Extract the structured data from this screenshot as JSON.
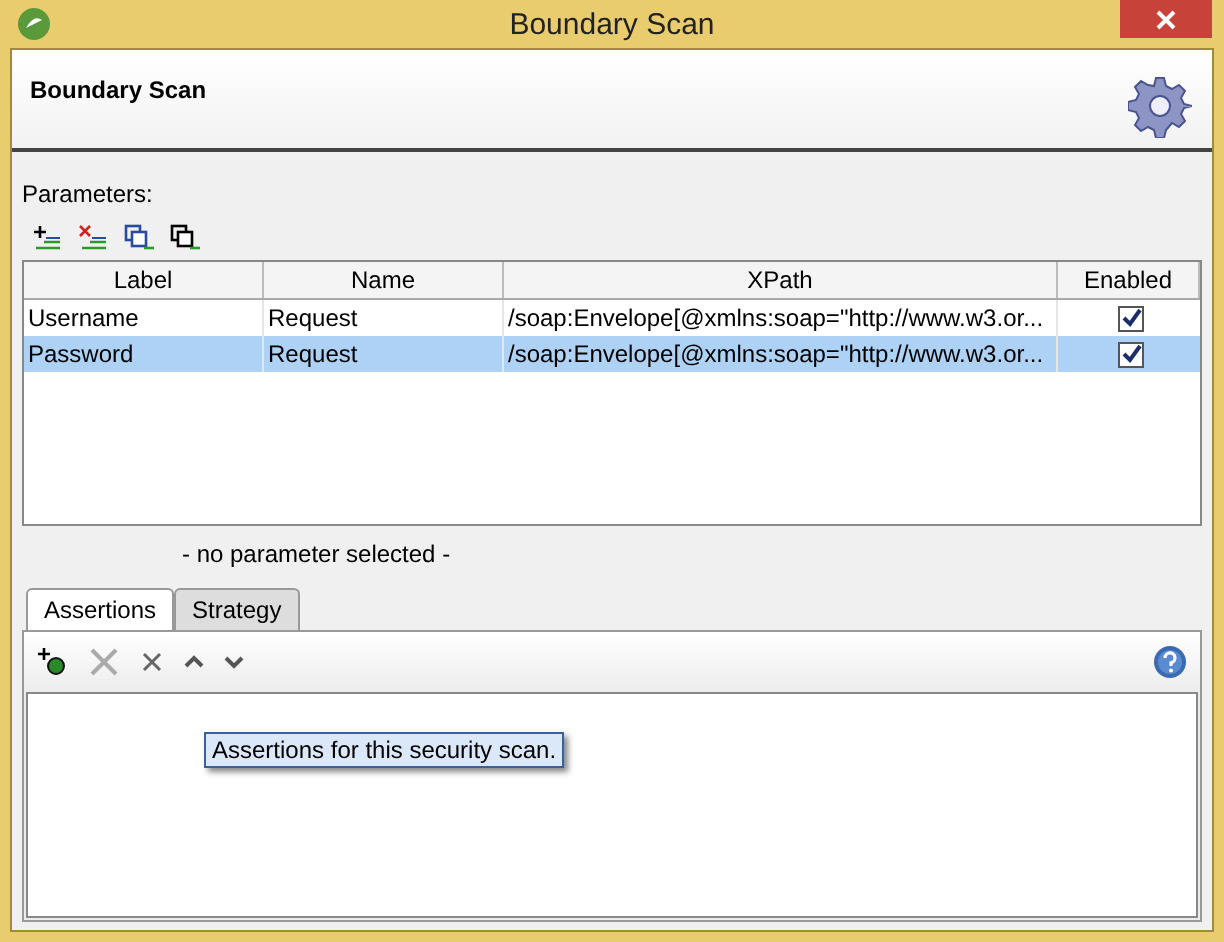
{
  "window": {
    "title": "Boundary Scan"
  },
  "header": {
    "title": "Boundary Scan"
  },
  "parameters": {
    "label": "Parameters:",
    "table": {
      "columns": [
        "Label",
        "Name",
        "XPath",
        "Enabled"
      ],
      "rows": [
        {
          "label": "Username",
          "name": "Request",
          "xpath": "/soap:Envelope[@xmlns:soap=\"http://www.w3.or...",
          "enabled": true,
          "selected": false
        },
        {
          "label": "Password",
          "name": "Request",
          "xpath": "/soap:Envelope[@xmlns:soap=\"http://www.w3.or...",
          "enabled": true,
          "selected": true
        }
      ]
    },
    "status": "- no parameter selected -"
  },
  "tabs": [
    {
      "label": "Assertions",
      "selected": true
    },
    {
      "label": "Strategy",
      "selected": false
    }
  ],
  "tooltip": "Assertions for this security scan."
}
